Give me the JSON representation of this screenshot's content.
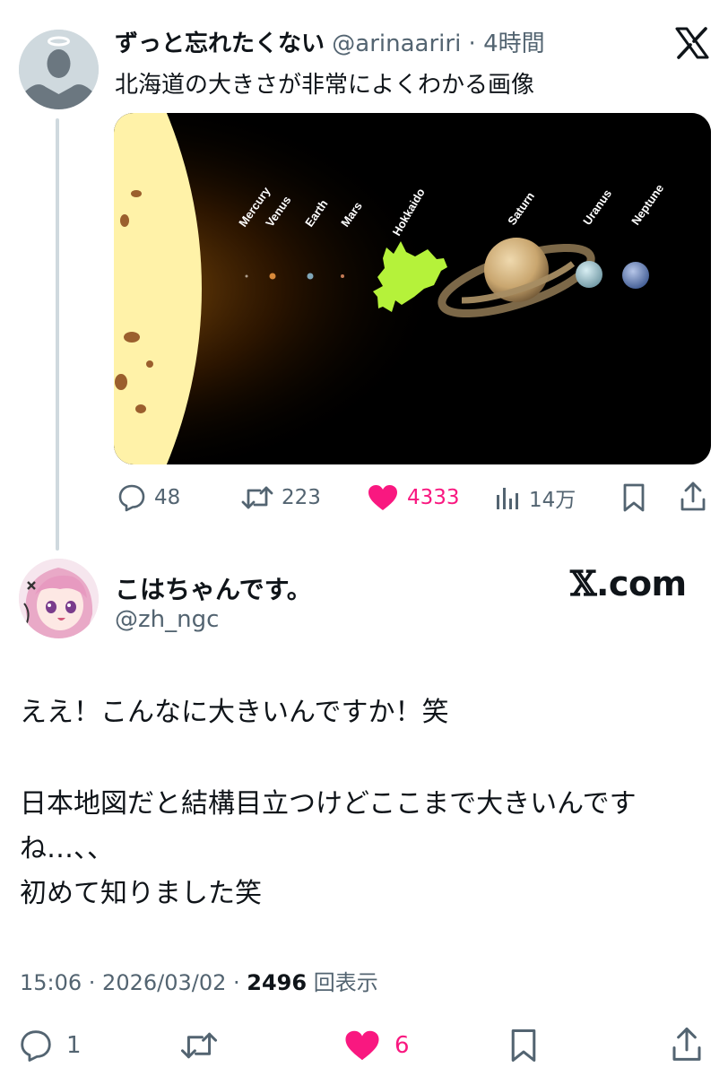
{
  "original_tweet": {
    "author_name": "ずっと忘れたくない",
    "author_handle": "@arinaariri",
    "separator": " · ",
    "time": "4時間",
    "text": "北海道の大きさが非常によくわかる画像",
    "media": {
      "labels": [
        "Mercury",
        "Venus",
        "Earth",
        "Mars",
        "Hokkaido",
        "Saturn",
        "Uranus",
        "Neptune"
      ]
    },
    "actions": {
      "replies": "48",
      "retweets": "223",
      "likes": "4333",
      "views": "14万"
    }
  },
  "reply": {
    "author_name": "こはちゃんです。",
    "author_handle": "@zh_ngc",
    "brand_x": "𝕏",
    "brand_suffix": ".com",
    "text_line1": "ええ！こんなに大きいんですか！笑",
    "text_line2": "日本地図だと結構目立つけどここまで大きいんです",
    "text_line3": "ね…、、",
    "text_line4": "初めて知りました笑",
    "timestamp": "15:06 · 2026/03/02 · ",
    "views_count": "2496",
    "views_label": "回表示",
    "actions": {
      "replies": "1",
      "likes": "6"
    }
  },
  "colors": {
    "like_pink": "#f91880",
    "text_gray": "#536471",
    "thread_line": "#cfd9de",
    "hokkaido_green": "#b5f23a"
  }
}
